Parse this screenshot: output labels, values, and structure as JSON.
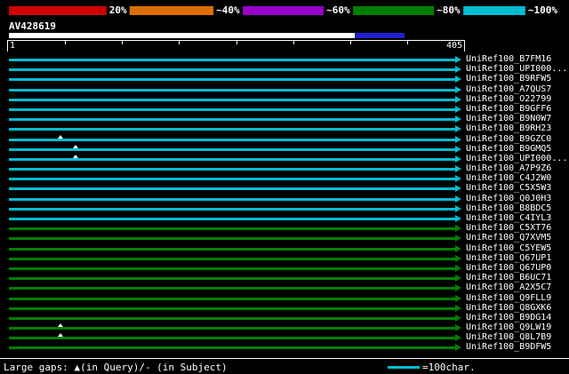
{
  "colors": {
    "cyan": "#00bcd0",
    "green": "#008000",
    "query_segment_blue": "#2020d0",
    "white": "#ffffff"
  },
  "color_key": {
    "segments": [
      {
        "label": "20%",
        "color": "#d00000"
      },
      {
        "label": "~40%",
        "color": "#dd6f00"
      },
      {
        "label": "~60%",
        "color": "#9900cc"
      },
      {
        "label": "~80%",
        "color": "#008000"
      },
      {
        "label": "~100%",
        "color": "#00bcd0"
      }
    ]
  },
  "query": {
    "name": "AV428619",
    "scale_start": "1",
    "scale_end": "405"
  },
  "alignments": [
    {
      "label": "UniRef100_B7FM16",
      "tier": "cyan",
      "gaps": []
    },
    {
      "label": "UniRef100_UPI000...",
      "tier": "cyan",
      "gaps": []
    },
    {
      "label": "UniRef100_B9RFW5",
      "tier": "cyan",
      "gaps": []
    },
    {
      "label": "UniRef100_A7QUS7",
      "tier": "cyan",
      "gaps": []
    },
    {
      "label": "UniRef100_O22799",
      "tier": "cyan",
      "gaps": []
    },
    {
      "label": "UniRef100_B9GFF6",
      "tier": "cyan",
      "gaps": []
    },
    {
      "label": "UniRef100_B9N0W7",
      "tier": "cyan",
      "gaps": []
    },
    {
      "label": "UniRef100_B9RH23",
      "tier": "cyan",
      "gaps": []
    },
    {
      "label": "UniRef100_B9GZC0",
      "tier": "cyan",
      "gaps": [
        11.5
      ]
    },
    {
      "label": "UniRef100_B9GMQ5",
      "tier": "cyan",
      "gaps": [
        15
      ]
    },
    {
      "label": "UniRef100_UPI000...",
      "tier": "cyan",
      "gaps": [
        15
      ]
    },
    {
      "label": "UniRef100_A7P9Z6",
      "tier": "cyan",
      "gaps": []
    },
    {
      "label": "UniRef100_C4J2W0",
      "tier": "cyan",
      "gaps": []
    },
    {
      "label": "UniRef100_C5X5W3",
      "tier": "cyan",
      "gaps": []
    },
    {
      "label": "UniRef100_Q0J0H3",
      "tier": "cyan",
      "gaps": []
    },
    {
      "label": "UniRef100_B8BDC5",
      "tier": "cyan",
      "gaps": []
    },
    {
      "label": "UniRef100_C4IYL3",
      "tier": "cyan",
      "gaps": []
    },
    {
      "label": "UniRef100_C5XT76",
      "tier": "green",
      "gaps": []
    },
    {
      "label": "UniRef100_Q7XVM5",
      "tier": "green",
      "gaps": []
    },
    {
      "label": "UniRef100_C5YEW5",
      "tier": "green",
      "gaps": []
    },
    {
      "label": "UniRef100_Q67UP1",
      "tier": "green",
      "gaps": []
    },
    {
      "label": "UniRef100_Q67UP0",
      "tier": "green",
      "gaps": []
    },
    {
      "label": "UniRef100_B6UC71",
      "tier": "green",
      "gaps": []
    },
    {
      "label": "UniRef100_A2X5C7",
      "tier": "green",
      "gaps": []
    },
    {
      "label": "UniRef100_Q9FLL9",
      "tier": "green",
      "gaps": []
    },
    {
      "label": "UniRef100_Q8GXK6",
      "tier": "green",
      "gaps": []
    },
    {
      "label": "UniRef100_B9DG14",
      "tier": "green",
      "gaps": []
    },
    {
      "label": "UniRef100_Q9LW19",
      "tier": "green",
      "gaps": [
        11.5
      ]
    },
    {
      "label": "UniRef100_Q8L7B9",
      "tier": "green",
      "gaps": [
        11.5
      ]
    },
    {
      "label": "UniRef100_B9DFW5",
      "tier": "green",
      "gaps": []
    }
  ],
  "footer": {
    "gaps_note": "Large gaps: ▲(in Query)/- (in Subject)",
    "legend_label": "=100char.",
    "legend_color": "#00bcd0"
  }
}
